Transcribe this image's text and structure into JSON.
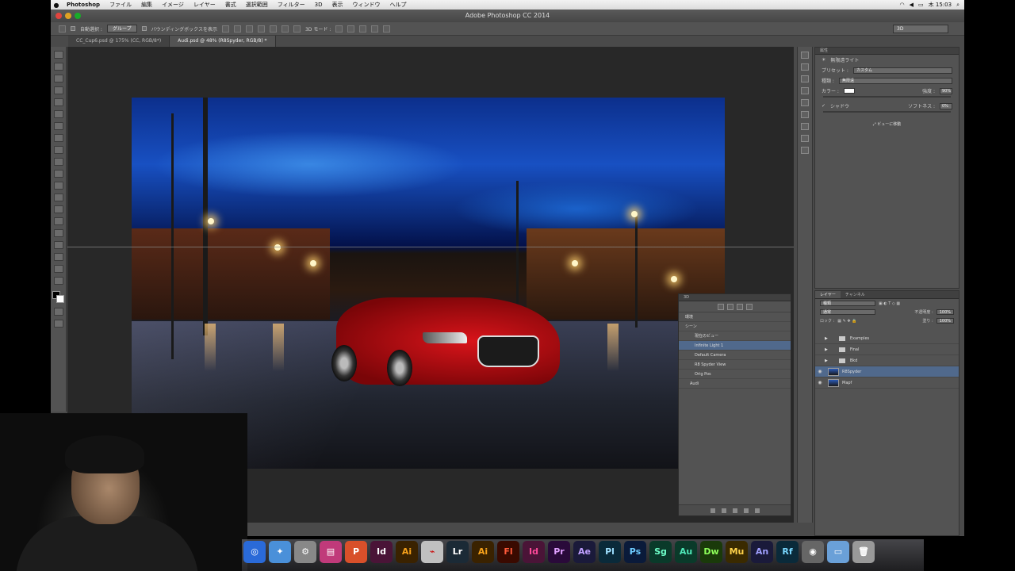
{
  "menubar": {
    "app": "Photoshop",
    "items": [
      "ファイル",
      "編集",
      "イメージ",
      "レイヤー",
      "書式",
      "選択範囲",
      "フィルター",
      "3D",
      "表示",
      "ウィンドウ",
      "ヘルプ"
    ],
    "clock": "木 15:03"
  },
  "window": {
    "title": "Adobe Photoshop CC 2014"
  },
  "options": {
    "auto_select": "自動選択 :",
    "group": "グループ",
    "show_transform": "バウンディングボックスを表示",
    "mode_3d": "3D モード :",
    "workspace": "3D"
  },
  "tabs": [
    {
      "label": "CC_Cup6.psd @ 175% (CC, RGB/8*)"
    },
    {
      "label": "Audi.psd @ 48% (R8Spyder, RGB/8) *"
    }
  ],
  "properties": {
    "header": "属性",
    "type_label": "無限遠ライト",
    "preset_label": "プリセット :",
    "preset_value": "カスタム",
    "kind_label": "種類 :",
    "kind_value": "無限遠",
    "color_label": "カラー :",
    "intensity_label": "強度 :",
    "intensity_value": "90%",
    "shadow_label": "シャドウ",
    "softness_label": "ソフトネス :",
    "softness_value": "0%",
    "move_to_view": "ビューに移動"
  },
  "layers": {
    "tab_layers": "レイヤー",
    "tab_channels": "チャンネル",
    "kind_filter": "種類",
    "blend": "通常",
    "opacity_label": "不透明度 :",
    "opacity_value": "100%",
    "lock_label": "ロック :",
    "fill_label": "塗り :",
    "fill_value": "100%",
    "items": [
      {
        "name": "Examples"
      },
      {
        "name": "Final"
      },
      {
        "name": "Bkd"
      },
      {
        "name": "R8Spyder"
      },
      {
        "name": "Mapf"
      }
    ]
  },
  "panel3d": {
    "header": "3D",
    "items": [
      {
        "name": "環境"
      },
      {
        "name": "シーン"
      },
      {
        "name": "現在のビュー"
      },
      {
        "name": "Infinite Light 1"
      },
      {
        "name": "Default Camera"
      },
      {
        "name": "R8 Spyder View"
      },
      {
        "name": "Orig Pos"
      },
      {
        "name": "Audi"
      }
    ]
  },
  "dock": {
    "apps": [
      {
        "label": "Id",
        "color": "#4a1437"
      },
      {
        "label": "Ai",
        "color": "#3a2200"
      },
      {
        "label": "",
        "color": "#c0c0c0"
      },
      {
        "label": "Lr",
        "color": "#1b2a36"
      },
      {
        "label": "Ai",
        "color": "#3a2200"
      },
      {
        "label": "Fl",
        "color": "#3a0a00"
      },
      {
        "label": "Id",
        "color": "#4a1437"
      },
      {
        "label": "Pr",
        "color": "#2a0a3a"
      },
      {
        "label": "Ae",
        "color": "#1a1a3a"
      },
      {
        "label": "Pl",
        "color": "#0a2a3a"
      },
      {
        "label": "Ps",
        "color": "#0a1a3a"
      },
      {
        "label": "Sg",
        "color": "#0a3a2a"
      },
      {
        "label": "Au",
        "color": "#0a3a2a"
      },
      {
        "label": "Dw",
        "color": "#1a3a0a"
      },
      {
        "label": "Mu",
        "color": "#3a2a00"
      },
      {
        "label": "An",
        "color": "#1a1a3a"
      },
      {
        "label": "Rf",
        "color": "#0a2a3a"
      }
    ]
  }
}
